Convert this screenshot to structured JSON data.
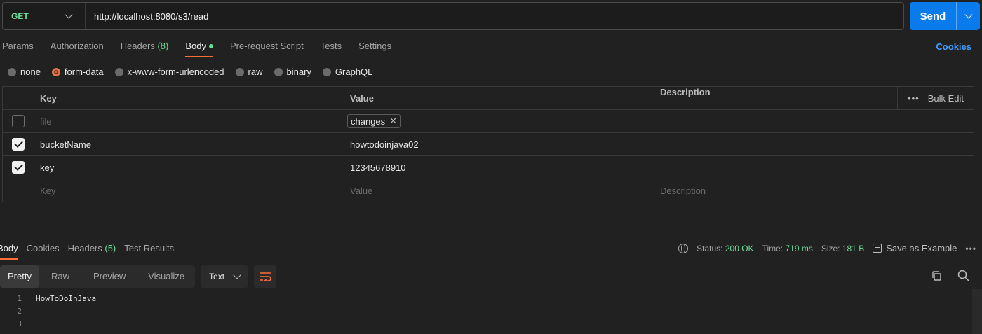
{
  "request": {
    "method": "GET",
    "url": "http://localhost:8080/s3/read",
    "send_label": "Send"
  },
  "request_tabs": [
    {
      "label": "Params"
    },
    {
      "label": "Authorization"
    },
    {
      "label": "Headers",
      "count": "(8)"
    },
    {
      "label": "Body"
    },
    {
      "label": "Pre-request Script"
    },
    {
      "label": "Tests"
    },
    {
      "label": "Settings"
    }
  ],
  "cookies_link": "Cookies",
  "body_types": [
    "none",
    "form-data",
    "x-www-form-urlencoded",
    "raw",
    "binary",
    "GraphQL"
  ],
  "selected_body_type": "form-data",
  "table": {
    "headers": {
      "key": "Key",
      "value": "Value",
      "description": "Description"
    },
    "bulk_edit": "Bulk Edit",
    "rows": [
      {
        "checked": false,
        "key": "file",
        "value_chip": "changes"
      },
      {
        "checked": true,
        "key": "bucketName",
        "value": "howtodoinjava02"
      },
      {
        "checked": true,
        "key": "key",
        "value": "12345678910"
      }
    ],
    "placeholders": {
      "key": "Key",
      "value": "Value",
      "description": "Description"
    }
  },
  "response": {
    "tabs": [
      {
        "label": "Body"
      },
      {
        "label": "Cookies"
      },
      {
        "label": "Headers",
        "count": "(5)"
      },
      {
        "label": "Test Results"
      }
    ],
    "status_label": "Status:",
    "status_value": "200 OK",
    "time_label": "Time:",
    "time_value": "719 ms",
    "size_label": "Size:",
    "size_value": "181 B",
    "save_example": "Save as Example",
    "view_modes": [
      "Pretty",
      "Raw",
      "Preview",
      "Visualize"
    ],
    "format": "Text",
    "lines": [
      {
        "n": "1",
        "text": "HowToDoInJava"
      },
      {
        "n": "2",
        "text": ""
      },
      {
        "n": "3",
        "text": ""
      }
    ]
  },
  "colors": {
    "accent": "#ff6c37",
    "send": "#097bed",
    "success": "#6bdd9a",
    "link": "#3f9cff"
  }
}
